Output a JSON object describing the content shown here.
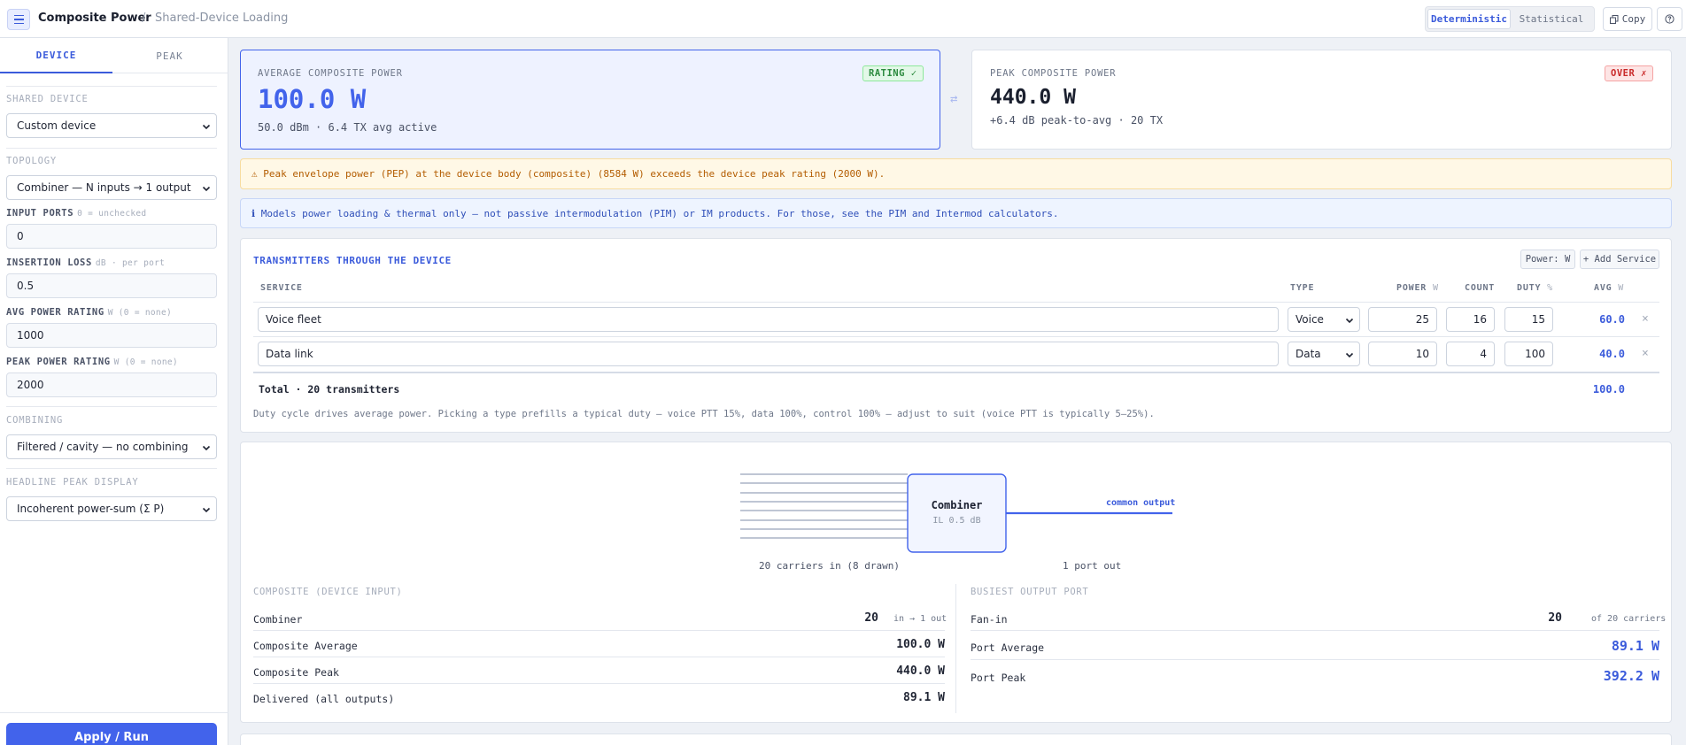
{
  "header": {
    "app_title": "Composite Power",
    "separator": "/",
    "page": "Shared-Device Loading",
    "modes": [
      "Deterministic",
      "Statistical"
    ],
    "active_mode": "Deterministic",
    "copy_label": "Copy"
  },
  "sidebar": {
    "tabs": [
      "DEVICE",
      "PEAK"
    ],
    "shared_device_label": "SHARED DEVICE",
    "shared_device_value": "Custom device",
    "topology_label": "TOPOLOGY",
    "topology_value": "Combiner — N inputs → 1 output",
    "input_ports_label": "INPUT PORTS",
    "input_ports_hint": "0 = unchecked",
    "input_ports_value": "0",
    "insertion_loss_label": "INSERTION LOSS",
    "insertion_loss_hint": "dB · per port",
    "insertion_loss_value": "0.5",
    "avg_power_label": "AVG POWER RATING",
    "avg_power_hint": "W (0 = none)",
    "avg_power_value": "1000",
    "peak_power_label": "PEAK POWER RATING",
    "peak_power_hint": "W (0 = none)",
    "peak_power_value": "2000",
    "combining_label": "COMBINING",
    "combining_value": "Filtered / cavity — no combining",
    "headline_label": "HEADLINE PEAK DISPLAY",
    "headline_value": "Incoherent power-sum (Σ P)",
    "apply_label": "Apply / Run"
  },
  "avg_card": {
    "label": "AVERAGE COMPOSITE POWER",
    "value": "100.0 W",
    "sub": "50.0 dBm · 6.4 TX avg active",
    "badge": "RATING ✓"
  },
  "swap_icon": "⇄",
  "peak_card": {
    "label": "PEAK COMPOSITE POWER",
    "value": "440.0 W",
    "sub": "+6.4 dB peak-to-avg · 20 TX",
    "badge": "OVER ✗"
  },
  "warning": "⚠ Peak envelope power (PEP) at the device body (composite) (8584 W) exceeds the device peak rating (2000 W).",
  "info": "ℹ Models power loading & thermal only — not passive intermodulation (PIM) or IM products. For those, see the PIM and Intermod calculators.",
  "tx_table": {
    "title": "TRANSMITTERS THROUGH THE DEVICE",
    "power_unit_btn": "Power: W",
    "add_btn": "+ Add Service",
    "headers": {
      "service": "SERVICE",
      "type": "TYPE",
      "power": "POWER",
      "power_unit": "W",
      "count": "COUNT",
      "duty": "DUTY",
      "duty_unit": "%",
      "avg": "AVG",
      "avg_unit": "W"
    },
    "rows": [
      {
        "service": "Voice fleet",
        "type": "Voice",
        "power": "25",
        "count": "16",
        "duty": "15",
        "avg": "60.0",
        "remove": "×"
      },
      {
        "service": "Data link",
        "type": "Data",
        "power": "10",
        "count": "4",
        "duty": "100",
        "avg": "40.0",
        "remove": "×"
      }
    ],
    "total_label": "Total · 20 transmitters",
    "total_avg": "100.0",
    "note": "Duty cycle drives average power. Picking a type prefills a typical duty — voice PTT 15%, data 100%, control 100% — adjust to suit (voice PTT is typically 5–25%)."
  },
  "diagram": {
    "box_title": "Combiner",
    "box_sub": "IL 0.5 dB",
    "output_label": "common output",
    "in_caption": "20 carriers in (8 drawn)",
    "out_caption": "1 port out"
  },
  "composite": {
    "title": "COMPOSITE (DEVICE INPUT)",
    "rows": [
      {
        "label": "Combiner",
        "value": "20",
        "note": "in → 1 out"
      },
      {
        "label": "Composite Average",
        "value": "100.0 W"
      },
      {
        "label": "Composite Peak",
        "value": "440.0 W"
      },
      {
        "label": "Delivered (all outputs)",
        "value": "89.1 W"
      }
    ]
  },
  "busiest": {
    "title": "BUSIEST OUTPUT PORT",
    "rows": [
      {
        "label": "Fan-in",
        "value": "20",
        "note": "of 20 carriers"
      },
      {
        "label": "Port Average",
        "value": "89.1 W"
      },
      {
        "label": "Port Peak",
        "value": "392.2 W"
      }
    ]
  },
  "colors": {
    "accent": "#3b5bdb",
    "rating_ok_bg": "#e3f8e8",
    "over_bg": "#fde5e5",
    "warn_bg": "#fff8e6",
    "info_bg": "#eef4ff"
  }
}
